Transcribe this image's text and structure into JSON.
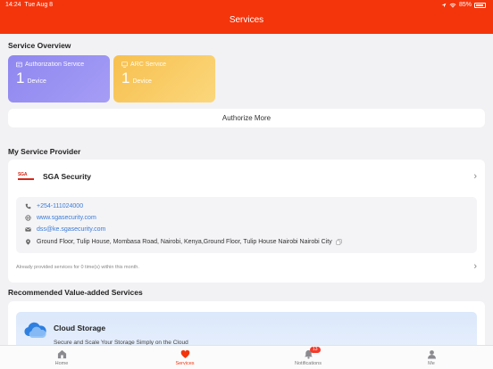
{
  "status_bar": {
    "time": "14:24",
    "date": "Tue Aug 8",
    "battery": "85%"
  },
  "header": {
    "title": "Services"
  },
  "overview": {
    "title": "Service Overview",
    "cards": [
      {
        "name": "Authorization Service",
        "count": "1",
        "unit": "Device",
        "color": "#9a92f2"
      },
      {
        "name": "ARC Service",
        "count": "1",
        "unit": "Device",
        "color": "#f8c65a"
      }
    ],
    "authorize_more": "Authorize More"
  },
  "provider": {
    "title": "My Service Provider",
    "name": "SGA Security",
    "logo_text": "SGA",
    "phone": "+254-111024000",
    "website": "www.sgasecurity.com",
    "email": "dss@ke.sgasecurity.com",
    "address": "Ground Floor, Tulip House, Mombasa Road, Nairobi, Kenya,Ground Floor, Tulip House Nairobi Nairobi City",
    "already_text": "Already provided services for 0 time(s) within this month."
  },
  "recommended": {
    "title": "Recommended Value-added Services",
    "item": {
      "name": "Cloud Storage",
      "subtitle": "Secure and Scale Your Storage Simply on the Cloud"
    }
  },
  "tabbar": {
    "tabs": [
      {
        "label": "Home",
        "icon": "home-icon"
      },
      {
        "label": "Services",
        "icon": "heart-icon"
      },
      {
        "label": "Notifications",
        "icon": "bell-icon",
        "badge": "13"
      },
      {
        "label": "Me",
        "icon": "person-icon"
      }
    ],
    "active": "Services",
    "accent": "#f4350c"
  }
}
